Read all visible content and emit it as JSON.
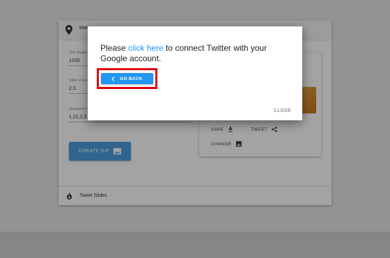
{
  "card": {
    "header_title": "Mak",
    "fields": [
      {
        "label": "GIF Image",
        "value": "1200"
      },
      {
        "label": "Slide Dura",
        "value": "2.5"
      },
      {
        "label": "Sequence",
        "value": "1,21,2,3"
      }
    ],
    "create_button_label": "CREATE GIF",
    "footer_label": "Tweet Slides"
  },
  "preview": {
    "save_label": "SAVE",
    "tweet_label": "TWEET",
    "change_label": "CHANGE"
  },
  "dialog": {
    "message_prefix": "Please ",
    "link_text": "click here",
    "message_suffix": " to connect Twitter with your Google account.",
    "go_back_label": "GO BACK",
    "close_label": "CLOSE"
  },
  "colors": {
    "primary": "#2196f3",
    "create_button": "#4a9fde",
    "highlight": "#e4000c"
  },
  "icons": [
    "map-pin-icon",
    "image-icon",
    "download-icon",
    "share-icon",
    "fire-icon",
    "chevron-left-icon"
  ]
}
